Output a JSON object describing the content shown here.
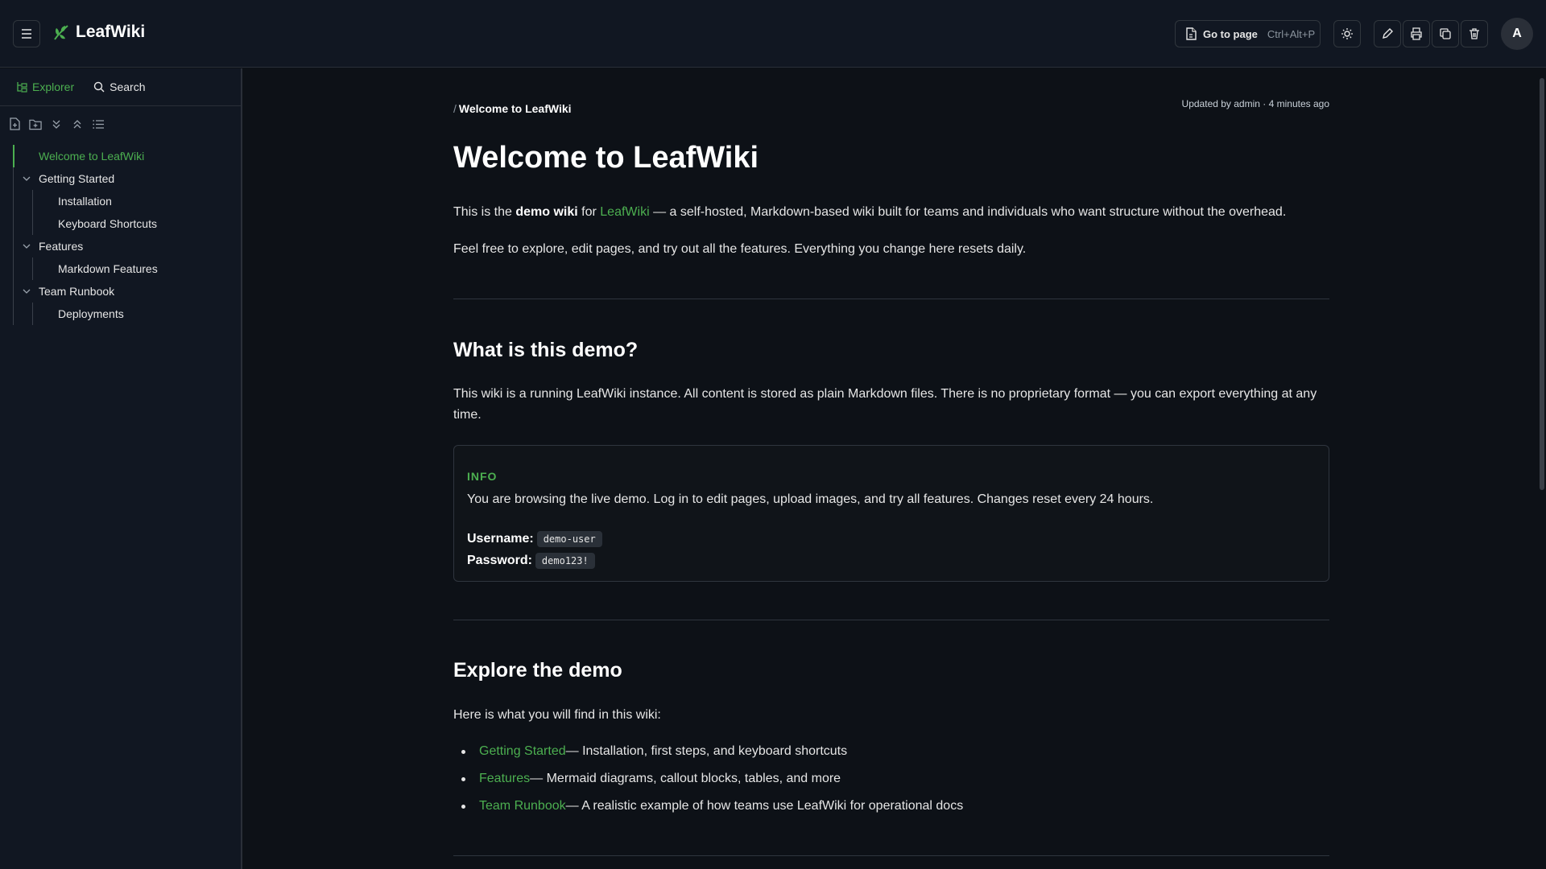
{
  "header": {
    "app_name": "LeafWiki",
    "goto_label": "Go to page",
    "goto_shortcut": "Ctrl+Alt+P",
    "avatar_initial": "A"
  },
  "sidebar": {
    "tabs": [
      {
        "label": "Explorer"
      },
      {
        "label": "Search"
      }
    ],
    "tree": [
      {
        "label": "Welcome to LeafWiki"
      },
      {
        "label": "Getting Started"
      },
      {
        "label": "Installation"
      },
      {
        "label": "Keyboard Shortcuts"
      },
      {
        "label": "Features"
      },
      {
        "label": "Markdown Features"
      },
      {
        "label": "Team Runbook"
      },
      {
        "label": "Deployments"
      }
    ]
  },
  "page": {
    "breadcrumb_sep": "/",
    "breadcrumb": "Welcome to LeafWiki",
    "updated": "Updated by admin · 4 minutes ago",
    "title": "Welcome to LeafWiki",
    "intro": {
      "t1": "This is the ",
      "b1": "demo wiki",
      "t2": " for ",
      "link": "LeafWiki",
      "t3": " — a self-hosted, Markdown-based wiki built for teams and individuals who want structure without the overhead."
    },
    "intro2": "Feel free to explore, edit pages, and try out all the features. Everything you change here resets daily.",
    "section1_title": "What is this demo?",
    "section1_text": "This wiki is a running LeafWiki instance. All content is stored as plain Markdown files. There is no proprietary format — you can export everything at any time.",
    "callout": {
      "title": "INFO",
      "text": "You are browsing the live demo. Log in to edit pages, upload images, and try all features. Changes reset every 24 hours.",
      "username_label": "Username:",
      "username": "demo-user",
      "password_label": "Password:",
      "password": "demo123!"
    },
    "section2_title": "Explore the demo",
    "section2_intro": "Here is what you will find in this wiki:",
    "items": [
      {
        "link": "Getting Started",
        "desc": " — Installation, first steps, and keyboard shortcuts"
      },
      {
        "link": "Features",
        "desc": " — Mermaid diagrams, callout blocks, tables, and more"
      },
      {
        "link": "Team Runbook",
        "desc": " — A realistic example of how teams use LeafWiki for operational docs"
      }
    ]
  },
  "colors": {
    "accent": "#4caf50",
    "background": "#0d1117",
    "panel": "#111722"
  }
}
